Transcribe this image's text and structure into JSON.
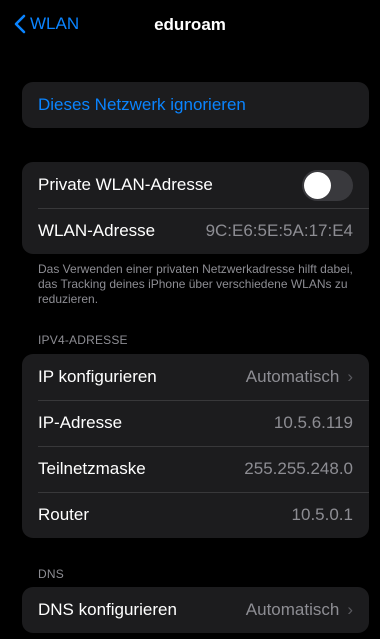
{
  "nav": {
    "back_label": "WLAN",
    "title": "eduroam"
  },
  "forget": {
    "label": "Dieses Netzwerk ignorieren"
  },
  "privacy": {
    "private_address_label": "Private WLAN-Adresse",
    "private_address_enabled": false,
    "wlan_address_label": "WLAN-Adresse",
    "wlan_address_value": "9C:E6:5E:5A:17:E4",
    "footer": "Das Verwenden einer privaten Netzwerkadresse hilft dabei, das Tracking deines iPhone über verschiedene WLANs zu reduzieren."
  },
  "ipv4": {
    "header": "IPV4-ADRESSE",
    "configure_label": "IP konfigurieren",
    "configure_value": "Automatisch",
    "ip_label": "IP-Adresse",
    "ip_value": "10.5.6.119",
    "subnet_label": "Teilnetzmaske",
    "subnet_value": "255.255.248.0",
    "router_label": "Router",
    "router_value": "10.5.0.1"
  },
  "dns": {
    "header": "DNS",
    "configure_label": "DNS konfigurieren",
    "configure_value": "Automatisch"
  },
  "icons": {
    "back": "chevron-left-icon",
    "disclosure": "chevron-right-icon"
  },
  "colors": {
    "accent": "#0a84ff",
    "background": "#000000",
    "cell": "#1c1c1e",
    "secondary_text": "#8d8d93",
    "toggle_off": "#39393d"
  }
}
